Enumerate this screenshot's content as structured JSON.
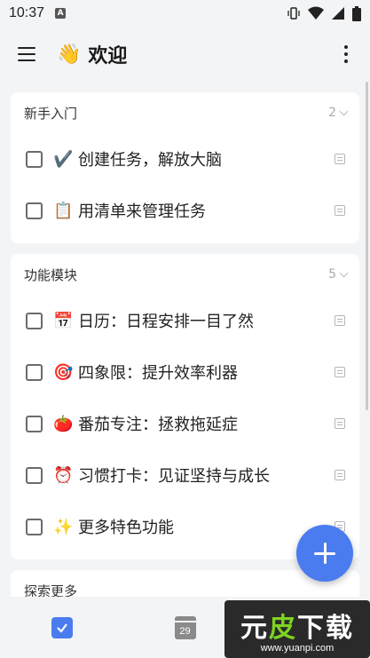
{
  "status_bar": {
    "time": "10:37",
    "notif_badge": "A"
  },
  "app_bar": {
    "title_emoji": "👋",
    "title": "欢迎"
  },
  "sections": [
    {
      "title": "新手入门",
      "count": "2",
      "tasks": [
        {
          "emoji": "✔️",
          "label": "创建任务，解放大脑"
        },
        {
          "emoji": "📋",
          "label": "用清单来管理任务"
        }
      ]
    },
    {
      "title": "功能模块",
      "count": "5",
      "tasks": [
        {
          "emoji": "📅",
          "label": "日历：日程安排一目了然"
        },
        {
          "emoji": "🎯",
          "label": "四象限：提升效率利器"
        },
        {
          "emoji": "🍅",
          "label": "番茄专注：拯救拖延症"
        },
        {
          "emoji": "⏰",
          "label": "习惯打卡：见证坚持与成长"
        },
        {
          "emoji": "✨",
          "label": "更多特色功能"
        }
      ]
    },
    {
      "title": "探索更多",
      "count": "",
      "tasks": []
    }
  ],
  "bottom_nav": {
    "calendar_day": "29"
  },
  "watermark": {
    "main_white_1": "元",
    "main_green": "皮",
    "main_white_2": "下载",
    "sub": "www.yuanpi.com"
  },
  "colors": {
    "accent": "#4a7cf0",
    "background": "#f3f4f6",
    "card": "#ffffff"
  }
}
